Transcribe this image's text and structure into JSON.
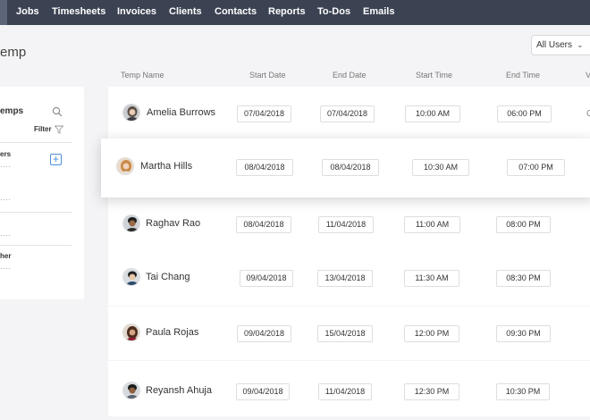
{
  "nav": {
    "items": [
      "Jobs",
      "Timesheets",
      "Invoices",
      "Clients",
      "Contacts",
      "Reports",
      "To-Dos",
      "Emails"
    ]
  },
  "page": {
    "title": "emp"
  },
  "filter": {
    "all_users": "All Users",
    "chevron": "⌄"
  },
  "columns": [
    "Temp Name",
    "Start Date",
    "End Date",
    "Start Time",
    "End Time",
    "V"
  ],
  "left_panel": {
    "heading": "emps",
    "filter_label": "Filter",
    "groups": [
      {
        "label": "ers",
        "dots": "...."
      },
      {
        "label": "",
        "dots": "...."
      },
      {
        "label": "",
        "dots": "...."
      },
      {
        "label": "her",
        "dots": "...."
      }
    ],
    "add": "+"
  },
  "rows": [
    {
      "name": "Amelia Burrows",
      "start_date": "07/04/2018",
      "end_date": "07/04/2018",
      "start_time": "10:00 AM",
      "end_time": "06:00 PM",
      "edge": "C"
    },
    {
      "name": "Martha Hills",
      "start_date": "08/04/2018",
      "end_date": "08/04/2018",
      "start_time": "10:30 AM",
      "end_time": "07:00 PM",
      "edge": ""
    },
    {
      "name": "Raghav Rao",
      "start_date": "08/04/2018",
      "end_date": "11/04/2018",
      "start_time": "11:00 AM",
      "end_time": "08:00 PM",
      "edge": ""
    },
    {
      "name": "Tai Chang",
      "start_date": "09/04/2018",
      "end_date": "13/04/2018",
      "start_time": "11:30 AM",
      "end_time": "08:30 PM",
      "edge": ""
    },
    {
      "name": "Paula Rojas",
      "start_date": "09/04/2018",
      "end_date": "15/04/2018",
      "start_time": "12:00 PM",
      "end_time": "09:30 PM",
      "edge": ""
    },
    {
      "name": "Reyansh Ahuja",
      "start_date": "09/04/2018",
      "end_date": "11/04/2018",
      "start_time": "12:30 PM",
      "end_time": "10:30 PM",
      "edge": ""
    }
  ],
  "colors": {
    "nav_bg": "#3b4252",
    "accent": "#4a90d9",
    "page_bg": "#f4f4f6"
  }
}
